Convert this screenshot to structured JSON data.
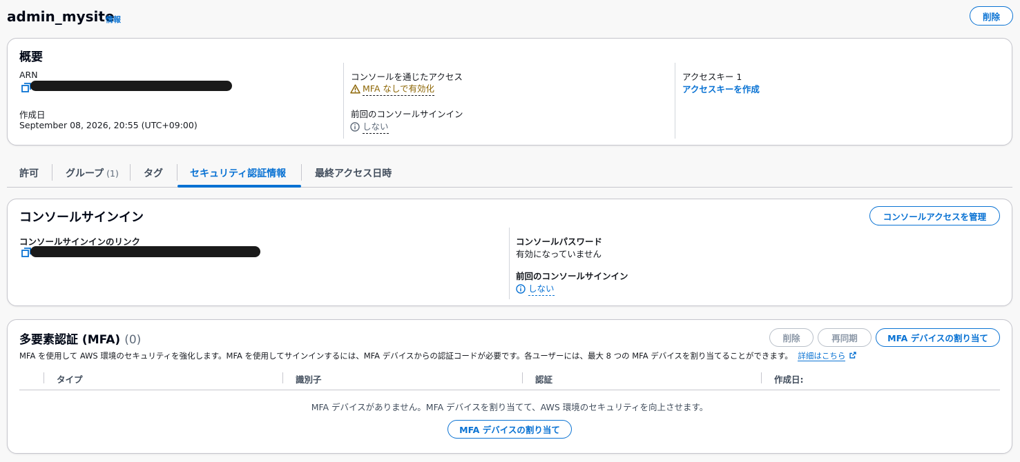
{
  "header": {
    "title": "admin_mysite",
    "info": "情報",
    "delete_label": "削除"
  },
  "summary": {
    "heading": "概要",
    "arn_label": "ARN",
    "created_label": "作成日",
    "created_value": "September 08, 2026, 20:55 (UTC+09:00)",
    "console_access_label": "コンソールを通じたアクセス",
    "console_access_value": "MFA なしで有効化",
    "last_signin_label": "前回のコンソールサインイン",
    "last_signin_value": "しない",
    "access_key_label": "アクセスキー 1",
    "create_access_key": "アクセスキーを作成"
  },
  "tabs": {
    "permissions": "許可",
    "groups": "グループ",
    "groups_count": "(1)",
    "tags": "タグ",
    "security": "セキュリティ認証情報",
    "last_accessed": "最終アクセス日時"
  },
  "console_signin": {
    "heading": "コンソールサインイン",
    "manage_label": "コンソールアクセスを管理",
    "link_label": "コンソールサインインのリンク",
    "password_label": "コンソールパスワード",
    "password_value": "有効になっていません",
    "last_signin_label": "前回のコンソールサインイン",
    "last_signin_value": "しない"
  },
  "mfa": {
    "heading": "多要素認証 (MFA)",
    "count": "(0)",
    "delete_label": "削除",
    "resync_label": "再同期",
    "assign_label": "MFA デバイスの割り当て",
    "description": "MFA を使用して AWS 環境のセキュリティを強化します。MFA を使用してサインインするには、MFA デバイスからの認証コードが必要です。各ユーザーには、最大 8 つの MFA デバイスを割り当てることができます。",
    "learn_more": "詳細はこちら",
    "columns": [
      "タイプ",
      "識別子",
      "認証",
      "作成日:"
    ],
    "empty_text": "MFA デバイスがありません。MFA デバイスを割り当てて、AWS 環境のセキュリティを向上させます。",
    "empty_assign_label": "MFA デバイスの割り当て"
  },
  "colors": {
    "accent": "#0972d3",
    "warning": "#8d6605",
    "text": "#16191f"
  }
}
